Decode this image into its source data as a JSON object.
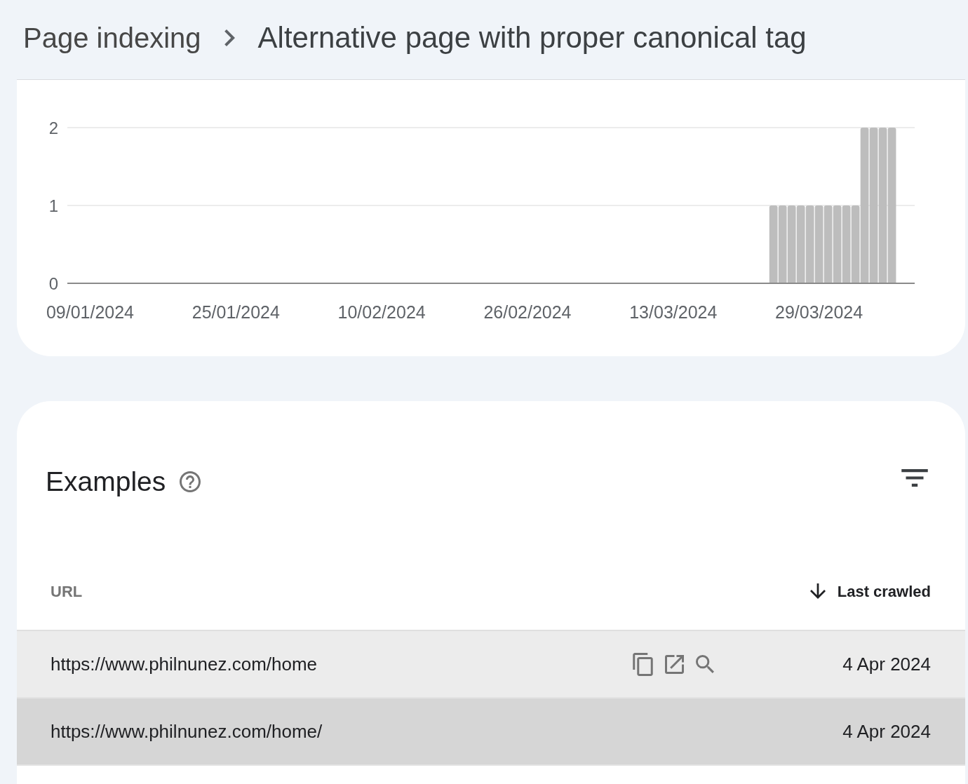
{
  "breadcrumb": [
    {
      "label": "Page indexing",
      "current": false
    },
    {
      "label": "Alternative page with proper canonical tag",
      "current": true
    }
  ],
  "chart": {
    "chart_data": {
      "type": "bar",
      "categories": [
        null,
        null,
        "09/01/2024",
        null,
        null,
        null,
        null,
        null,
        null,
        null,
        null,
        null,
        null,
        null,
        null,
        null,
        null,
        null,
        "25/01/2024",
        null,
        null,
        null,
        null,
        null,
        null,
        null,
        null,
        null,
        null,
        null,
        null,
        null,
        null,
        null,
        "10/02/2024",
        null,
        null,
        null,
        null,
        null,
        null,
        null,
        null,
        null,
        null,
        null,
        null,
        null,
        null,
        null,
        "26/02/2024",
        null,
        null,
        null,
        null,
        null,
        null,
        null,
        null,
        null,
        null,
        null,
        null,
        null,
        null,
        null,
        "13/03/2024",
        null,
        null,
        null,
        null,
        null,
        null,
        null,
        null,
        null,
        null,
        null,
        null,
        null,
        null,
        null,
        "29/03/2024",
        null,
        null,
        null,
        null,
        null,
        null,
        null,
        null,
        null,
        null
      ],
      "values": [
        0,
        0,
        0,
        0,
        0,
        0,
        0,
        0,
        0,
        0,
        0,
        0,
        0,
        0,
        0,
        0,
        0,
        0,
        0,
        0,
        0,
        0,
        0,
        0,
        0,
        0,
        0,
        0,
        0,
        0,
        0,
        0,
        0,
        0,
        0,
        0,
        0,
        0,
        0,
        0,
        0,
        0,
        0,
        0,
        0,
        0,
        0,
        0,
        0,
        0,
        0,
        0,
        0,
        0,
        0,
        0,
        0,
        0,
        0,
        0,
        0,
        0,
        0,
        0,
        0,
        0,
        0,
        0,
        0,
        0,
        0,
        0,
        0,
        0,
        0,
        0,
        0,
        1,
        1,
        1,
        1,
        1,
        1,
        1,
        1,
        1,
        1,
        2,
        2,
        2,
        2,
        null,
        null
      ],
      "ylim": [
        0,
        2
      ],
      "yticks": [
        0,
        1,
        2
      ]
    }
  },
  "examples": {
    "title": "Examples",
    "table": {
      "columns": [
        {
          "label": "URL",
          "sorted": false
        },
        {
          "label": "Last crawled",
          "sorted": true,
          "descending": true
        }
      ],
      "rows": [
        {
          "url": "https://www.philnunez.com/home",
          "last_crawled": "4 Apr 2024",
          "hovered": true,
          "selected": false
        },
        {
          "url": "https://www.philnunez.com/home/",
          "last_crawled": "4 Apr 2024",
          "hovered": false,
          "selected": true
        }
      ]
    }
  }
}
